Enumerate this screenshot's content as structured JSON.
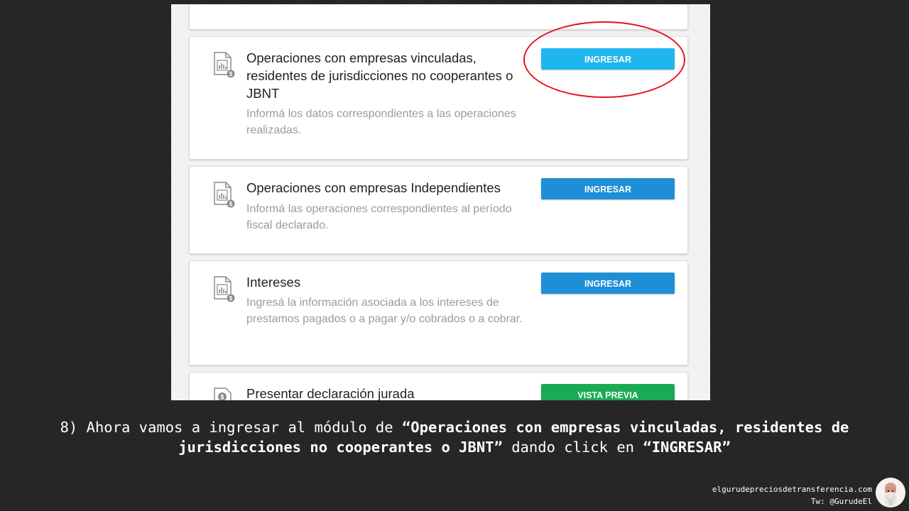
{
  "cards": [
    {
      "title": "Operaciones con empresas vinculadas, residentes de jurisdicciones no cooperantes o JBNT",
      "description": "Informá los datos correspondientes a las operaciones realizadas.",
      "button": "INGRESAR",
      "icon": "report-document-icon"
    },
    {
      "title": "Operaciones con empresas Independientes",
      "description": "Informá las operaciones correspondientes al período fiscal declarado.",
      "button": "INGRESAR",
      "icon": "report-document-icon"
    },
    {
      "title": "Intereses",
      "description": "Ingresá la información asociada a los intereses de prestamos pagados o a pagar y/o cobrados o a cobrar.",
      "button": "INGRESAR",
      "icon": "report-document-icon"
    },
    {
      "title": "Presentar declaración jurada",
      "button": "VISTA PREVIA",
      "icon": "money-document-icon"
    }
  ],
  "instruction": {
    "prefix": "8) Ahora vamos a ingresar al módulo de ",
    "bold_module": "“Operaciones con empresas vinculadas, residentes de jurisdicciones no cooperantes o JBNT”",
    "middle": " dando click en ",
    "bold_action": "“INGRESAR”"
  },
  "footer": {
    "website": "elgurudepreciosdetransferencia.com",
    "twitter": "Tw: @GurudeEl"
  },
  "colors": {
    "button_highlighted": "#1fb5ee",
    "button_primary": "#1e8fd6",
    "button_preview": "#1aaa55",
    "annotation_circle": "#e3141c",
    "slide_background": "#262626"
  }
}
